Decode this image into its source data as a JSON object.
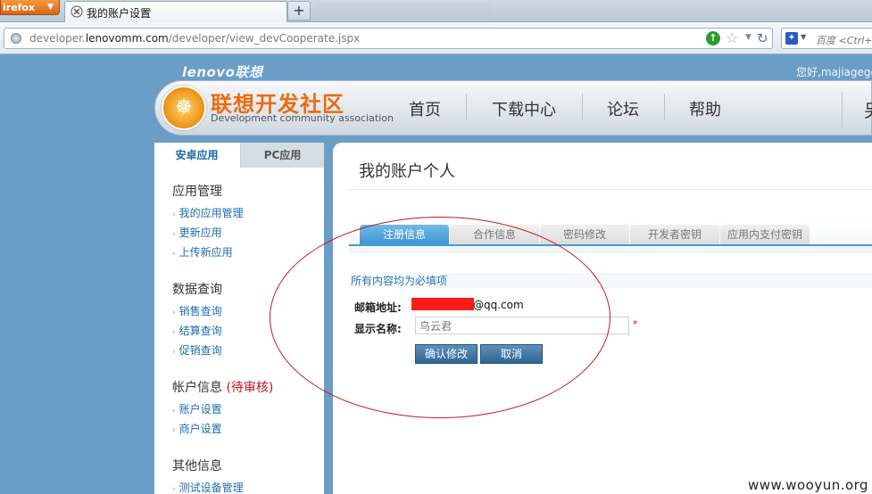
{
  "browser": {
    "menu_button": "irefox",
    "tab_title": "我的账户设置",
    "new_tab": "+",
    "url_prefix": "developer.",
    "url_host": "lenovomm.com",
    "url_path": "/developer/view_devCooperate.jspx",
    "search_placeholder": "百度 <Ctrl+"
  },
  "header": {
    "brand": "lenovo联想",
    "greeting": "您好,majiagege",
    "site_name": "联想开发社区",
    "site_subtitle": "Development community association",
    "nav": [
      "首页",
      "下载中心",
      "论坛",
      "帮助"
    ],
    "nav_cut": "另"
  },
  "sidebar": {
    "tabs": [
      "安卓应用",
      "PC应用"
    ],
    "sections": [
      {
        "title": "应用管理",
        "items": [
          "我的应用管理",
          "更新应用",
          "上传新应用"
        ]
      },
      {
        "title": "数据查询",
        "items": [
          "销售查询",
          "结算查询",
          "促销查询"
        ]
      },
      {
        "title": "帐户信息",
        "badge": "(待审核)",
        "items": [
          "账户设置",
          "商户设置"
        ]
      },
      {
        "title": "其他信息",
        "items": [
          "测试设备管理"
        ]
      }
    ]
  },
  "main": {
    "title": "我的账户个人",
    "tabs": [
      "注册信息",
      "合作信息",
      "密码修改",
      "开发者密钥",
      "应用内支付密钥"
    ],
    "active_tab": "注册信息",
    "required_note": "所有内容均为必填项",
    "email_label": "邮箱地址:",
    "email_suffix": "@qq.com",
    "name_label": "显示名称:",
    "name_value": "乌云君",
    "required_star": "*",
    "confirm_button": "确认修改",
    "cancel_button": "取消"
  },
  "watermark": "www.wooyun.org",
  "colors": {
    "accent_blue": "#3d95d2",
    "link_blue": "#1f6ba8",
    "brand_orange": "#e96d0e",
    "annotation_red": "#c31a1a",
    "redaction_red": "#ff1a1a"
  }
}
